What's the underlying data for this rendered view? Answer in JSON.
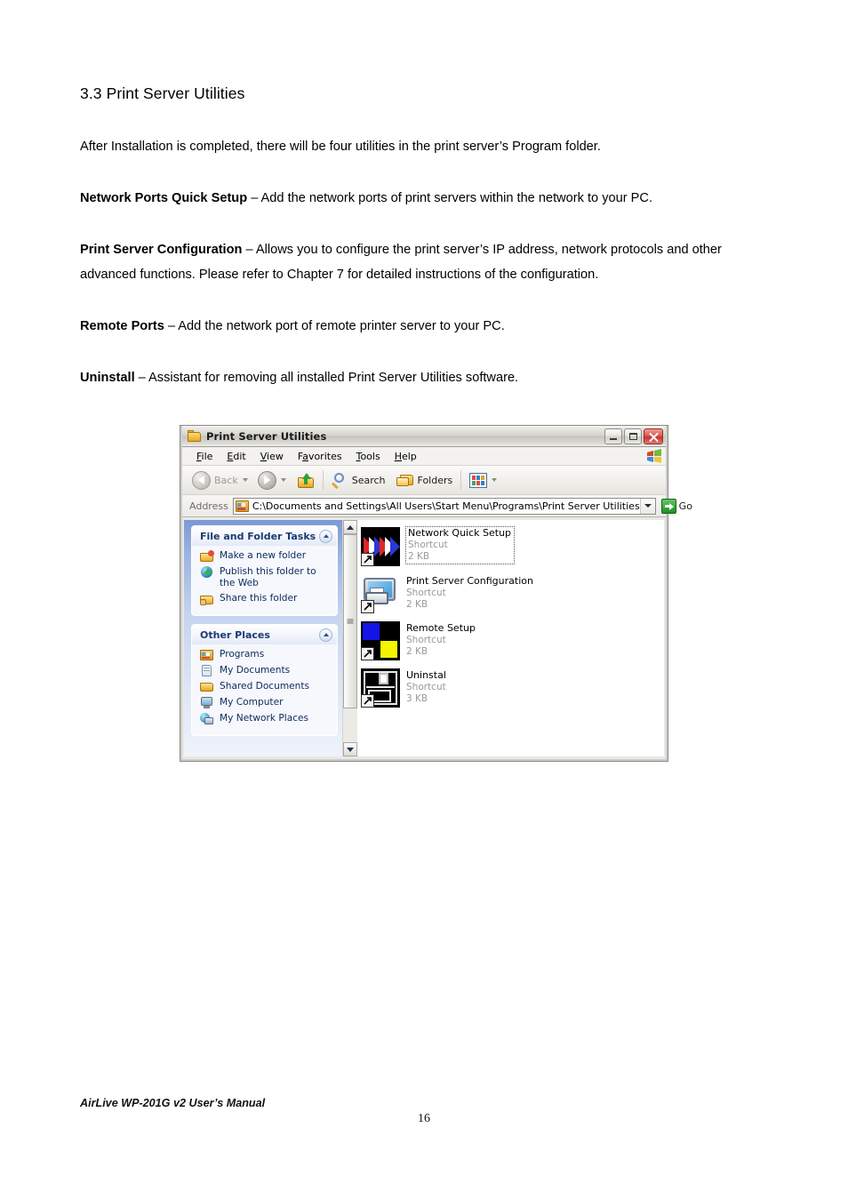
{
  "document": {
    "heading": "3.3 Print Server Utilities",
    "intro": "After Installation is completed, there will be four utilities in the print server’s Program folder.",
    "items": [
      {
        "term": "Network Ports Quick Setup",
        "desc": " – Add the network ports of print servers within the network to your PC."
      },
      {
        "term": "Print Server Configuration",
        "desc": " – Allows you to configure the print server’s IP address, network protocols and other advanced functions. Please refer to Chapter 7 for detailed instructions of the configuration."
      },
      {
        "term": "Remote Ports",
        "desc": " – Add the network port of remote printer server to your PC."
      },
      {
        "term": "Uninstall",
        "desc": " – Assistant for removing all installed Print Server Utilities software."
      }
    ]
  },
  "footer": {
    "manual": "AirLive WP-201G v2 User’s Manual",
    "page_number": "16"
  },
  "explorer": {
    "title": "Print Server Utilities",
    "window_buttons": {
      "minimize": "Minimize",
      "maximize": "Maximize",
      "close": "Close"
    },
    "menu": [
      {
        "label": "File",
        "accel": "F",
        "rest": "ile"
      },
      {
        "label": "Edit",
        "accel": "E",
        "rest": "dit"
      },
      {
        "label": "View",
        "accel": "V",
        "rest": "iew"
      },
      {
        "label": "Favorites",
        "accel": "F",
        "rest": "avorites"
      },
      {
        "label": "Tools",
        "accel": "T",
        "rest": "ools"
      },
      {
        "label": "Help",
        "accel": "H",
        "rest": "elp"
      }
    ],
    "toolbar": {
      "back": "Back",
      "forward": "Forward",
      "up": "Up",
      "search": "Search",
      "folders": "Folders",
      "views": "Views"
    },
    "address": {
      "label": "Address",
      "value": "C:\\Documents and Settings\\All Users\\Start Menu\\Programs\\Print Server Utilities",
      "go_label": "Go"
    },
    "sidebar": {
      "panels": [
        {
          "title": "File and Folder Tasks",
          "links": [
            "Make a new folder",
            "Publish this folder to the Web",
            "Share this folder"
          ]
        },
        {
          "title": "Other Places",
          "links": [
            "Programs",
            "My Documents",
            "Shared Documents",
            "My Computer",
            "My Network Places"
          ]
        }
      ]
    },
    "files": [
      {
        "name": "Network Quick Setup",
        "type": "Shortcut",
        "size": "2 KB",
        "selected": true
      },
      {
        "name": "Print Server Configuration",
        "type": "Shortcut",
        "size": "2 KB",
        "selected": false
      },
      {
        "name": "Remote Setup",
        "type": "Shortcut",
        "size": "2 KB",
        "selected": false
      },
      {
        "name": "Uninstal",
        "type": "Shortcut",
        "size": "3 KB",
        "selected": false
      }
    ]
  },
  "colors": {
    "sidebar_blue": "#7a9ad4",
    "panel_title": "#1b3a73",
    "close_red": "#c5352c",
    "go_green": "#1f8f27",
    "selection_icon_blue": "#1414e6",
    "selection_icon_yellow": "#f5f500"
  }
}
